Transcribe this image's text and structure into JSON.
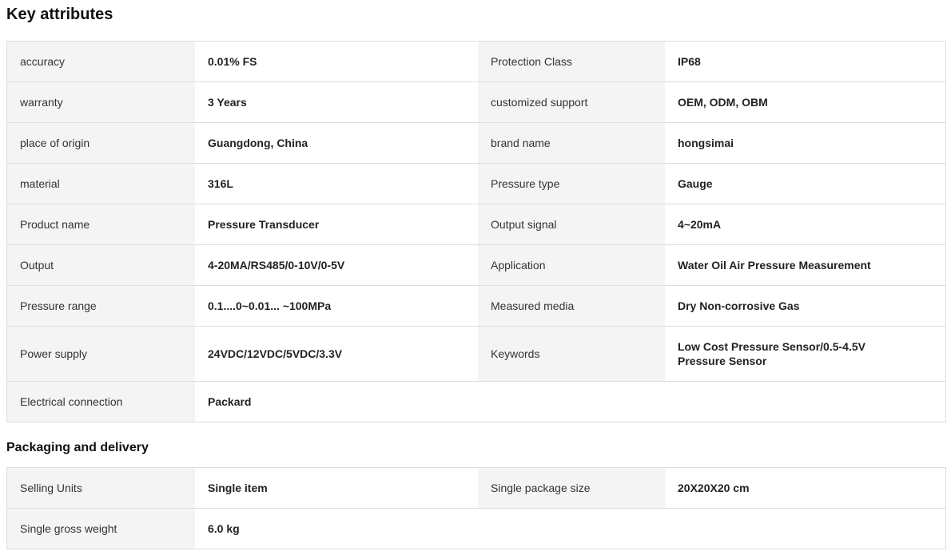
{
  "key_attributes": {
    "heading": "Key attributes",
    "rows": [
      [
        "accuracy",
        "0.01% FS",
        "Protection Class",
        "IP68"
      ],
      [
        "warranty",
        "3 Years",
        "customized support",
        "OEM, ODM, OBM"
      ],
      [
        "place of origin",
        "Guangdong, China",
        "brand name",
        "hongsimai"
      ],
      [
        "material",
        "316L",
        "Pressure type",
        "Gauge"
      ],
      [
        "Product name",
        "Pressure Transducer",
        "Output signal",
        "4~20mA"
      ],
      [
        "Output",
        "4-20MA/RS485/0-10V/0-5V",
        "Application",
        "Water Oil Air Pressure Measurement"
      ],
      [
        "Pressure range",
        "0.1....0~0.01... ~100MPa",
        "Measured media",
        "Dry Non-corrosive Gas"
      ],
      [
        "Power supply",
        "24VDC/12VDC/5VDC/3.3V",
        "Keywords",
        "Low Cost Pressure Sensor/0.5-4.5V Pressure Sensor"
      ],
      [
        "Electrical connection",
        "Packard",
        "",
        ""
      ]
    ]
  },
  "packaging": {
    "heading": "Packaging and delivery",
    "rows": [
      [
        "Selling Units",
        "Single item",
        "Single package size",
        "20X20X20 cm"
      ],
      [
        "Single gross weight",
        "6.0 kg",
        "",
        ""
      ]
    ]
  }
}
